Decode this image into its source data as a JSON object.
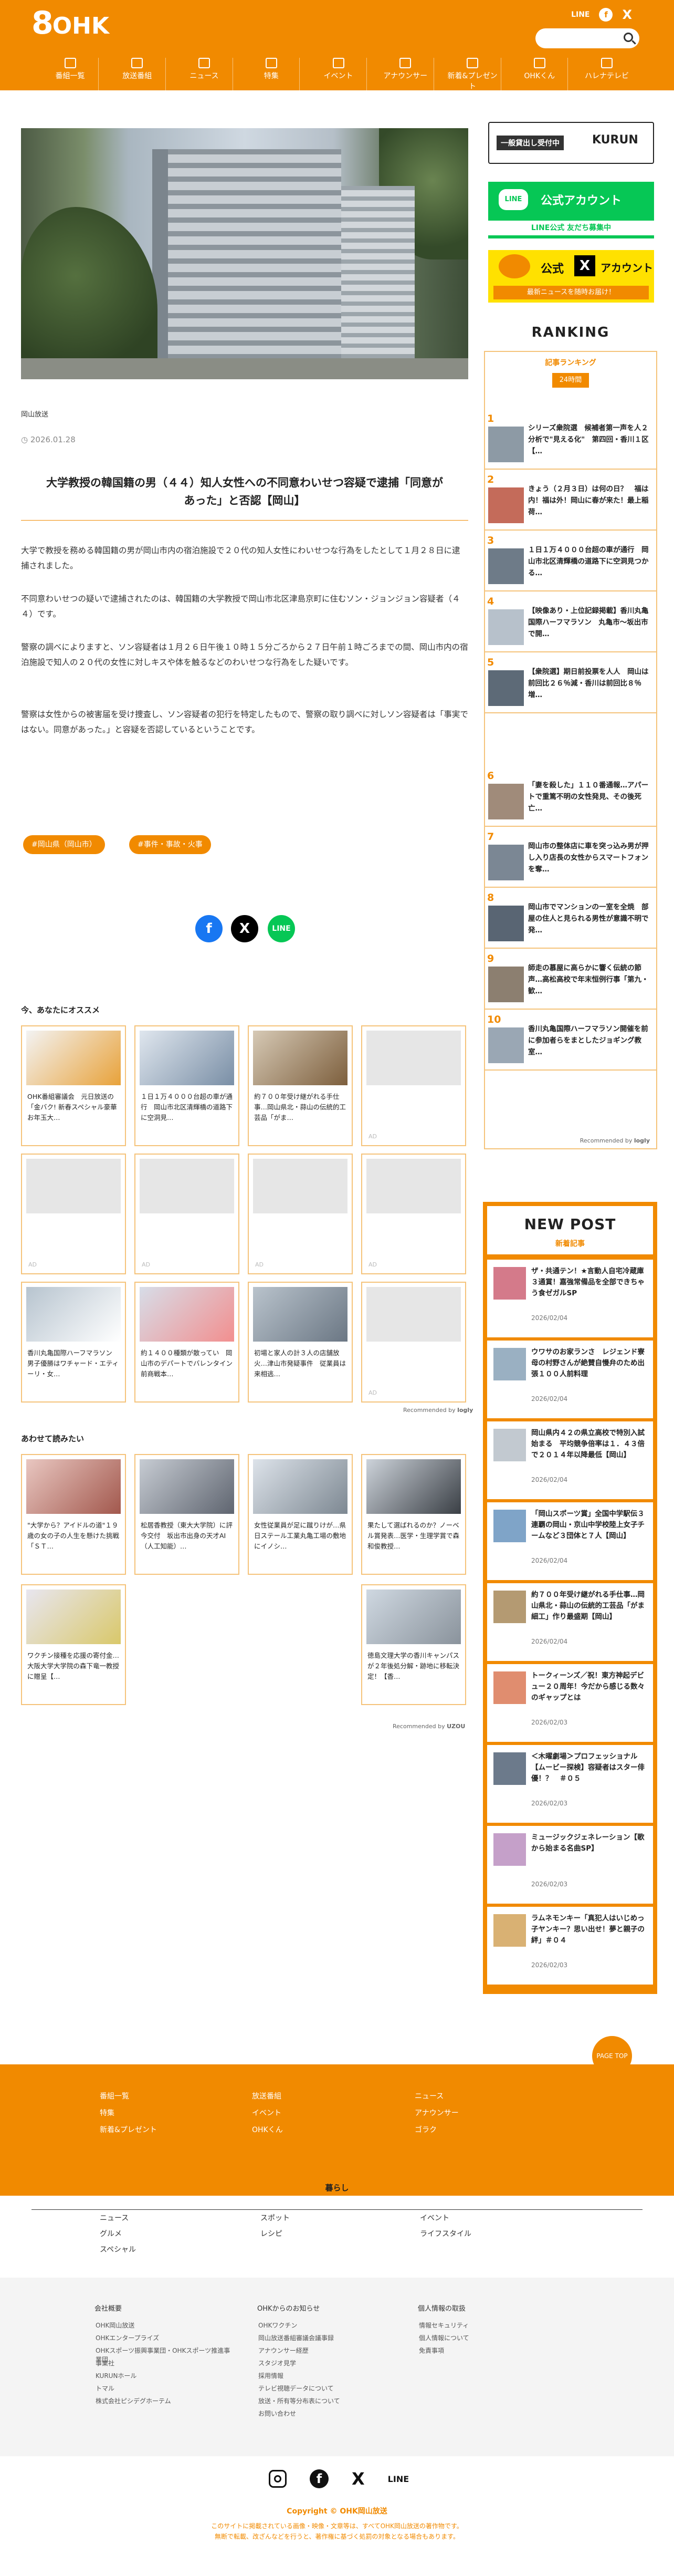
{
  "header": {
    "logo_num": "8",
    "logo_text": "OHK",
    "line_label": "LINE",
    "search_placeholder": "",
    "nav": [
      "番組一覧",
      "放送番組",
      "ニュース",
      "特集",
      "イベント",
      "アナウンサー",
      "新着&プレゼント",
      "OHKくん",
      "ハレナテレビ"
    ]
  },
  "article": {
    "credit": "岡山放送",
    "date": "2026.01.28",
    "title_lines": [
      "大学教授の韓国籍の男（４４）知人女性への不同意わいせつ容疑で逮捕「同意が",
      "あった」と否認【岡山】"
    ],
    "paragraphs": [
      "大学で教授を務める韓国籍の男が岡山市内の宿泊施設で２０代の知人女性にわいせつな行為をしたとして１月２８日に逮捕されました。",
      "不同意わいせつの疑いで逮捕されたのは、韓国籍の大学教授で岡山市北区津島京町に住むソン・ジョンジョン容疑者（４４）です。",
      "警察の調べによりますと、ソン容疑者は１月２６日午後１０時１５分ごろから２７日午前１時ごろまでの間、岡山市内の宿泊施設で知人の２０代の女性に対しキスや体を触るなどのわいせつな行為をした疑いです。",
      "警察は女性からの被害届を受け捜査し、ソン容疑者の犯行を特定したもので、警察の取り調べに対しソン容疑者は「事実ではない。同意があった。」と容疑を否認しているということです。"
    ],
    "tags": [
      "#岡山県（岡山市）",
      "#事件・事故・火事"
    ]
  },
  "recommend": {
    "heading": "今、あなたにオススメ",
    "ad_label": "AD",
    "cards": [
      "OHK番組審議会　元日放送の「金バク! 新春スペシャル豪華お年玉大…",
      "１日１万４０００台超の車が通行　岡山市北区清輝橋の道路下に空洞見…",
      "約７００年受け継がれる手仕事…岡山県北・蒜山の伝統的工芸品「がま…",
      "",
      "",
      "",
      "",
      "",
      "香川丸亀国際ハーフマラソン　男子優勝はワチャード・エティーリ・女…",
      "約１４００種類が散ってい　岡山市のデパートでバレンタイン前商戦本…",
      "初場と家人の計３人の店舗放火…津山市発疑事件　従業員は来相逃…",
      "",
      ""
    ],
    "recommended_by": "Recommended by",
    "rec_brand": "logly"
  },
  "related": {
    "heading": "あわせて読みたい",
    "cards": [
      "\"大学から？アイドルの道\"１９歳の女の子の人生を懸けた挑戦「ＳＴ…",
      "松居香教授（東大大学院）に評今交付　坂出市出身の天才AI（人工知能）…",
      "女性従業員が足に蹴りけが…県日ステール工業丸亀工場の敷地にイノシ…",
      "果たして選ばれるのか？ノーベル賞発表…医学・生理学賞で森和俊教授…",
      "ワクチン接種を応援の寄付金…大阪大学大学院の森下竜一教授に贈呈【…",
      "徳島文理大学の香川キャンパスが２年後処分解・跡地に移転決定！【香…"
    ],
    "powered_by": "Recommended by",
    "brand": "UZOU"
  },
  "sidebar": {
    "banner1": "一般貸出し受付中",
    "banner1_brand": "KURUN",
    "banner2_title": "公式アカウント",
    "banner2_sub": "LINE公式 友だち募集中",
    "banner3_title": "公式",
    "banner3_title2": "アカウント",
    "banner3_sub": "最新ニュースを随時お届け！",
    "ranking_heading": "RANKING",
    "ranking_sub": "記事ランキング",
    "ranking_tab": "24時間",
    "ranking": [
      {
        "num": "1",
        "text": "シリーズ衆院選　候補者第一声を人２分析で\"見える化\"　第四回・香川１区【…"
      },
      {
        "num": "2",
        "text": "きょう（２月３日）は何の日？　福は内！福は外！岡山に春が来た！最上稲荷…"
      },
      {
        "num": "3",
        "text": "１日１万４０００台超の車が通行　岡山市北区清輝橋の道路下に空洞見つかる…"
      },
      {
        "num": "4",
        "text": "【映像あり・上位記録掲載】香川丸亀国際ハーフマラソン　丸亀市〜坂出市で開…"
      },
      {
        "num": "5",
        "text": "【衆院選】期日前投票を人人　岡山は前回比２６％減・香川は前回比８％増…"
      },
      {
        "num": "6",
        "text": "「妻を殺した」１１０番通報…アパートで重篤不明の女性発見、その後死亡…"
      },
      {
        "num": "7",
        "text": "岡山市の整体店に車を突っ込み男が押し入り店長の女性からスマートフォンを奪…"
      },
      {
        "num": "8",
        "text": "岡山市でマンションの一室を全焼　部屋の住人と見られる男性が意識不明で発…"
      },
      {
        "num": "9",
        "text": "師走の慕屋に高らかに響く伝統の節声…高松高校で年末恒例行事「第九・歓…"
      },
      {
        "num": "10",
        "text": "香川丸亀国際ハーフマラソン開催を前に参加者らをまとしたジョギング教室…"
      }
    ],
    "recommended_by": "Recommended by",
    "rec_brand": "logly",
    "newpost_heading": "NEW POST",
    "newpost_sub": "新着記事",
    "newpost": [
      {
        "text": "ザ・共通テン！★言動人自宅冷蔵庫３通賞！嘉強常備品を全部できちゃう食ゼガルSP",
        "date": "2026/02/04"
      },
      {
        "text": "ウワサのお家ランさ　レジェンド寮母の村野さんが絶賛自慢弁のため出張１００人前料理",
        "date": "2026/02/04"
      },
      {
        "text": "岡山県内４２の県立高校で特別入試始まる　平均競争倍率は１．４３倍で２０１４年以降最低【岡山】",
        "date": "2026/02/04"
      },
      {
        "text": "「岡山スポーツ賞」全国中学駅伝３連覇の岡山・京山中学校陸上女子チームなど３団体と７人【岡山】",
        "date": "2026/02/04"
      },
      {
        "text": "約７００年受け継がれる手仕事…岡山県北・蒜山の伝統的工芸品「がま細工」作り最盛期【岡山】",
        "date": "2026/02/04"
      },
      {
        "text": "トークィーンズ／祝！東方神起デビュー２０周年！今だから感じる数々のギャップとは",
        "date": "2026/02/03"
      },
      {
        "text": "＜木曜劇場＞プロフェッショナル【ムービー探検】容疑者はスター俳優！？　＃０５",
        "date": "2026/02/03"
      },
      {
        "text": "ミュージックジェネレーション【歌から始まる名曲SP】",
        "date": "2026/02/03"
      },
      {
        "text": "ラムネモンキー「真犯人はいじめっ子ヤンキー？思い出せ！夢と親子の絆」＃０４",
        "date": "2026/02/03"
      }
    ]
  },
  "footer": {
    "pagetop": "PAGE TOP",
    "col1": [
      "番組一覧",
      "特集",
      "新着&プレゼント"
    ],
    "col2": [
      "放送番組",
      "イベント",
      "OHKくん"
    ],
    "col3": [
      "ニュース",
      "アナウンサー",
      "ゴラク"
    ],
    "kurashi_heading": "暮らし",
    "k1": [
      "ニュース",
      "グルメ",
      "スペシャル"
    ],
    "k2": [
      "スポット",
      "レシピ"
    ],
    "k3": [
      "イベント",
      "ライフスタイル"
    ],
    "corp_heading": "会社概要",
    "corp": [
      "OHK岡山放送",
      "OHKエンタープライズ",
      "OHKスポーツ振興事業団・OHKスポーツ推進事業団",
      "事業社",
      "KURUNホール",
      "トマル",
      "株式会社ピシデグホーテム"
    ],
    "notice_heading": "OHKからのお知らせ",
    "notice": [
      "OHKワクチン",
      "岡山放送番組審議会議事録",
      "アナウンサー経歴",
      "スタジオ見学",
      "採用情報",
      "テレビ視聴データについて",
      "放送・所有等分布表について",
      "お問い合わせ"
    ],
    "privacy_heading": "個人情報の取扱",
    "privacy": [
      "情報セキュリティ",
      "個人情報について",
      "免責事項"
    ],
    "copyright": "Copyright © OHK岡山放送",
    "note1": "このサイトに掲載されている画像・映像・文章等は、すべてOHK岡山放送の著作物です。",
    "note2": "無断で転載、改ざんなどを行うと、著作権に基づく処罰の対象となる場合もあります。"
  },
  "colors": {
    "brand": "#f18a00",
    "line": "#06c755",
    "facebook": "#1877f2",
    "x": "#000000"
  }
}
